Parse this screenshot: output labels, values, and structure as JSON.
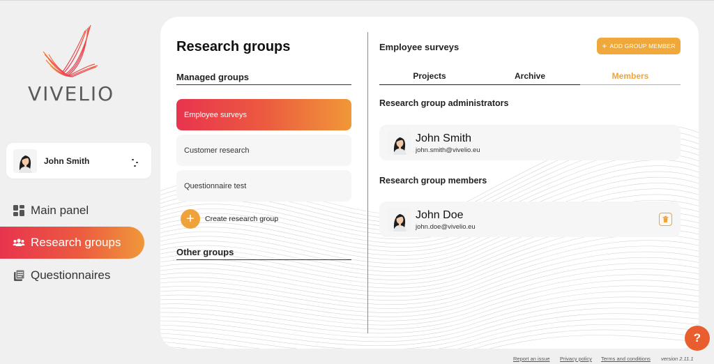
{
  "app": {
    "brand": "VIVELIO",
    "accent": "#f0a23a",
    "gradient_start": "#e8344e",
    "gradient_end": "#f0983a"
  },
  "sidebar": {
    "user": {
      "name": "John Smith"
    },
    "nav": [
      {
        "label": "Main panel",
        "icon": "dashboard-icon"
      },
      {
        "label": "Research groups",
        "icon": "people-icon",
        "active": true
      },
      {
        "label": "Questionnaires",
        "icon": "documents-icon"
      }
    ]
  },
  "left_panel": {
    "title": "Research groups",
    "managed_heading": "Managed groups",
    "groups": [
      {
        "label": "Employee surveys",
        "active": true
      },
      {
        "label": "Customer research"
      },
      {
        "label": "Questionnaire test"
      }
    ],
    "create_label": "Create research group",
    "other_heading": "Other groups"
  },
  "right_panel": {
    "title": "Employee surveys",
    "add_button": "ADD GROUP MEMBER",
    "tabs": [
      {
        "label": "Projects"
      },
      {
        "label": "Archive"
      },
      {
        "label": "Members",
        "active": true
      }
    ],
    "admins_heading": "Research group administrators",
    "admins": [
      {
        "name": "John Smith",
        "email": "john.smith@vivelio.eu"
      }
    ],
    "members_heading": "Research group members",
    "members": [
      {
        "name": "John Doe",
        "email": "john.doe@vivelio.eu"
      }
    ]
  },
  "footer": {
    "report": "Report an issue",
    "privacy": "Privacy policy",
    "terms": "Terms and conditions",
    "version": "version 2.11.1"
  },
  "help": {
    "label": "?"
  }
}
